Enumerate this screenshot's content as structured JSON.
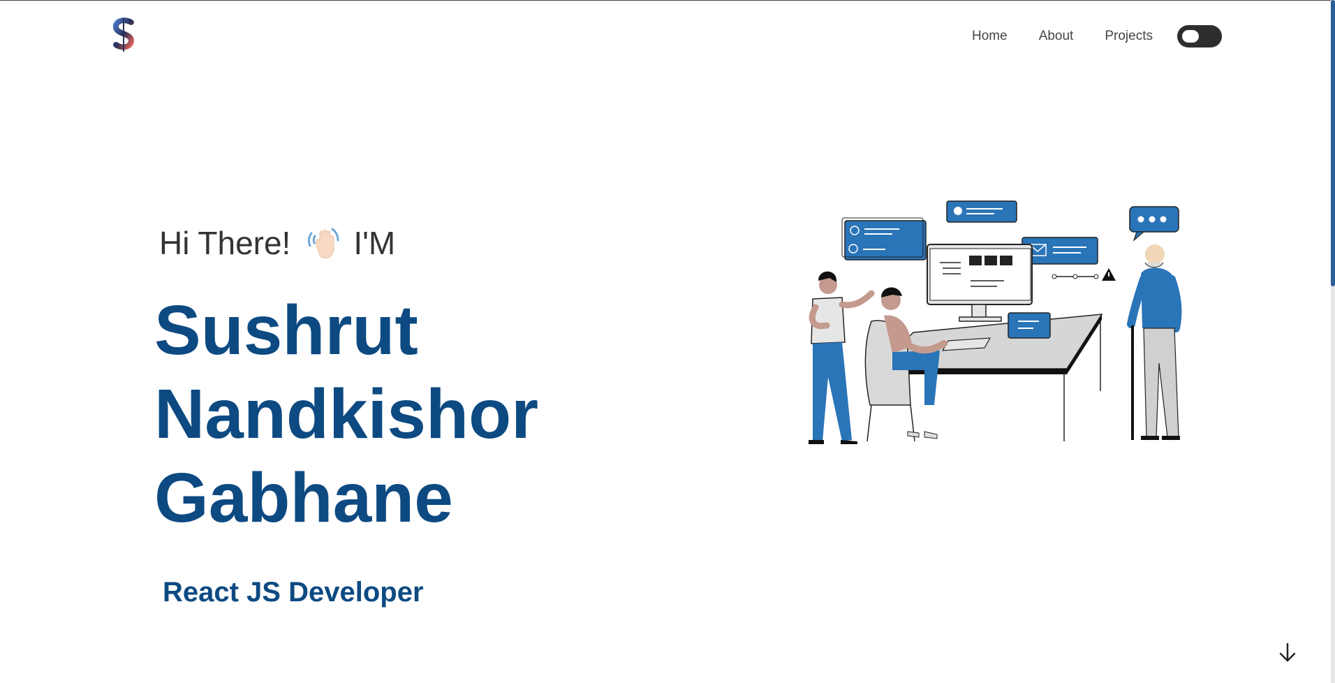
{
  "nav": {
    "items": [
      {
        "label": "Home"
      },
      {
        "label": "About"
      },
      {
        "label": "Projects"
      }
    ],
    "theme_toggle": {
      "state": "dark"
    }
  },
  "hero": {
    "greeting_pre": "Hi There!",
    "greeting_post": "I'M",
    "name_lines": [
      "Sushrut",
      "Nandkishor",
      "Gabhane"
    ],
    "role": "React JS Developer"
  },
  "colors": {
    "primary": "#0d4a82",
    "accent": "#2a74b8",
    "text": "#333333"
  },
  "icons": {
    "logo": "s-logo",
    "wave": "waving-hand-icon",
    "scroll": "arrow-down-icon"
  }
}
